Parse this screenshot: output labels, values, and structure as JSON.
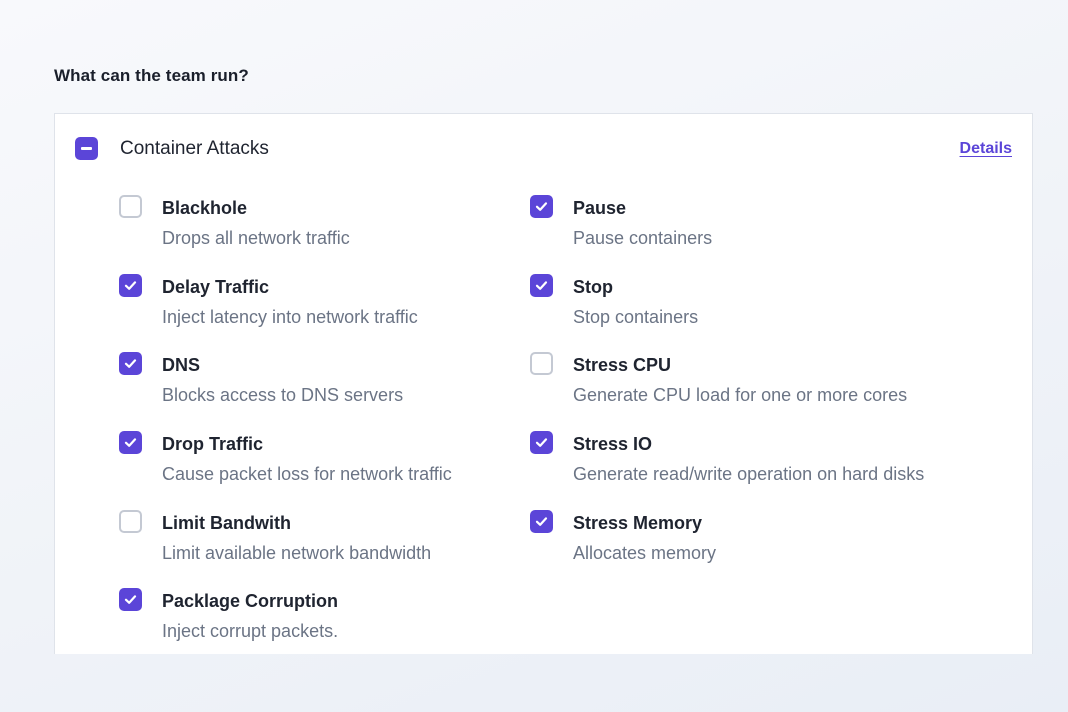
{
  "heading": "What can the team run?",
  "group": {
    "title": "Container Attacks",
    "state": "indeterminate",
    "details_label": "Details"
  },
  "left_items": [
    {
      "title": "Blackhole",
      "description": "Drops all network traffic",
      "checked": false
    },
    {
      "title": "Delay Traffic",
      "description": "Inject latency into network traffic",
      "checked": true
    },
    {
      "title": "DNS",
      "description": "Blocks access to DNS servers",
      "checked": true
    },
    {
      "title": "Drop Traffic",
      "description": "Cause packet loss for network traffic",
      "checked": true
    },
    {
      "title": "Limit Bandwith",
      "description": "Limit available network bandwidth",
      "checked": false
    },
    {
      "title": "Packlage Corruption",
      "description": "Inject corrupt packets.",
      "checked": true
    }
  ],
  "right_items": [
    {
      "title": "Pause",
      "description": "Pause containers",
      "checked": true
    },
    {
      "title": "Stop",
      "description": "Stop containers",
      "checked": true
    },
    {
      "title": "Stress CPU",
      "description": "Generate CPU load for one or more cores",
      "checked": false
    },
    {
      "title": "Stress IO",
      "description": "Generate read/write operation on hard disks",
      "checked": true
    },
    {
      "title": "Stress Memory",
      "description": "Allocates memory",
      "checked": true
    }
  ],
  "colors": {
    "accent": "#5b45d8",
    "checkbox_border": "#c4c9d3",
    "title_text": "#1f2430",
    "description_text": "#6b7485"
  },
  "icons": {
    "checked": "checkmark-icon",
    "group_state": "minus-icon"
  }
}
